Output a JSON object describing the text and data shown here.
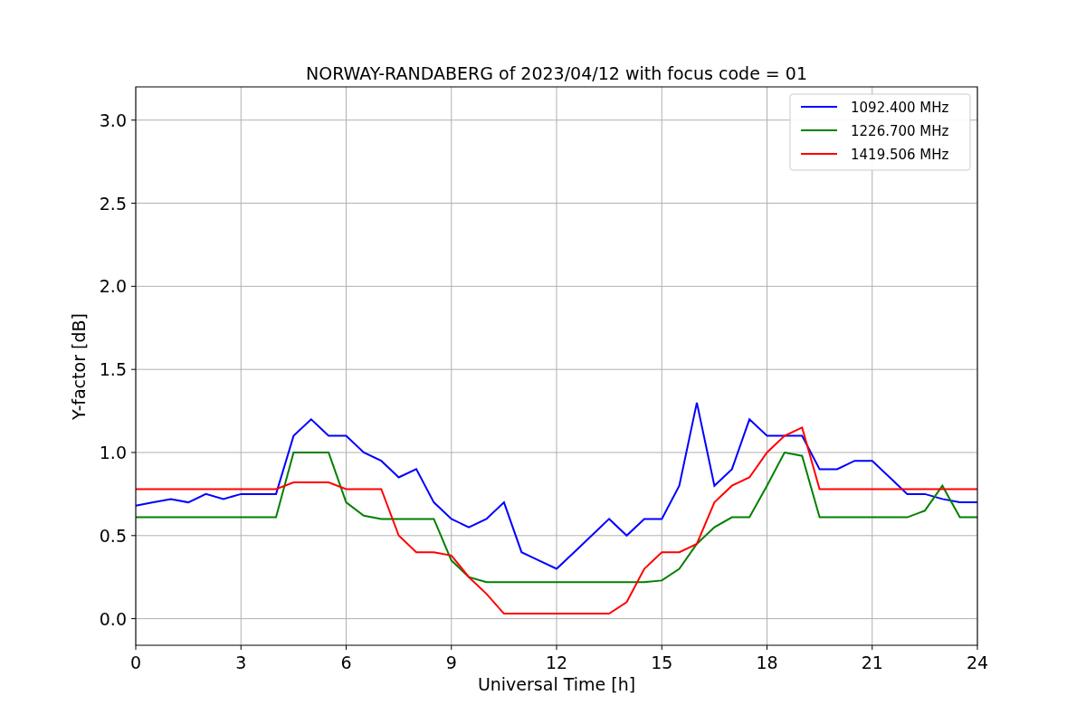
{
  "figure": {
    "chart_data": {
      "type": "line",
      "title": "NORWAY-RANDABERG of 2023/04/12 with focus code = 01",
      "xlabel": "Universal Time [h]",
      "ylabel": "Y-factor [dB]",
      "x": [
        0,
        0.5,
        1,
        1.5,
        2,
        2.5,
        3,
        3.5,
        4,
        4.5,
        5,
        5.5,
        6,
        6.5,
        7,
        7.5,
        8,
        8.5,
        9,
        9.5,
        10,
        10.5,
        11,
        11.5,
        12,
        12.5,
        13,
        13.5,
        14,
        14.5,
        15,
        15.5,
        16,
        16.5,
        17,
        17.5,
        18,
        18.5,
        19,
        19.5,
        20,
        20.5,
        21,
        21.5,
        22,
        22.5,
        23,
        23.5,
        24
      ],
      "series": [
        {
          "name": "1092.400 MHz",
          "color": "#0000ff",
          "values": [
            0.68,
            0.7,
            0.72,
            0.7,
            0.75,
            0.72,
            0.75,
            0.75,
            0.75,
            1.1,
            1.2,
            1.1,
            1.1,
            1.0,
            0.95,
            0.85,
            0.9,
            0.7,
            0.6,
            0.55,
            0.6,
            0.7,
            0.4,
            0.35,
            0.3,
            0.4,
            0.5,
            0.6,
            0.5,
            0.6,
            0.6,
            0.8,
            1.3,
            0.8,
            0.9,
            1.2,
            1.1,
            1.1,
            1.1,
            0.9,
            0.9,
            0.95,
            0.95,
            0.85,
            0.75,
            0.75,
            0.72,
            0.7,
            0.7
          ]
        },
        {
          "name": "1226.700 MHz",
          "color": "#008000",
          "values": [
            0.61,
            0.61,
            0.61,
            0.61,
            0.61,
            0.61,
            0.61,
            0.61,
            0.61,
            1.0,
            1.0,
            1.0,
            0.7,
            0.62,
            0.6,
            0.6,
            0.6,
            0.6,
            0.35,
            0.25,
            0.22,
            0.22,
            0.22,
            0.22,
            0.22,
            0.22,
            0.22,
            0.22,
            0.22,
            0.22,
            0.23,
            0.3,
            0.45,
            0.55,
            0.61,
            0.61,
            0.8,
            1.0,
            0.98,
            0.61,
            0.61,
            0.61,
            0.61,
            0.61,
            0.61,
            0.65,
            0.8,
            0.61,
            0.61
          ]
        },
        {
          "name": "1419.506 MHz",
          "color": "#ff0000",
          "values": [
            0.78,
            0.78,
            0.78,
            0.78,
            0.78,
            0.78,
            0.78,
            0.78,
            0.78,
            0.82,
            0.82,
            0.82,
            0.78,
            0.78,
            0.78,
            0.5,
            0.4,
            0.4,
            0.38,
            0.25,
            0.15,
            0.03,
            0.03,
            0.03,
            0.03,
            0.03,
            0.03,
            0.03,
            0.1,
            0.3,
            0.4,
            0.4,
            0.45,
            0.7,
            0.8,
            0.85,
            1.0,
            1.1,
            1.15,
            0.78,
            0.78,
            0.78,
            0.78,
            0.78,
            0.78,
            0.78,
            0.78,
            0.78,
            0.78
          ]
        }
      ],
      "grid": true,
      "legend": true,
      "xlim": [
        0,
        24
      ],
      "ylim": [
        -0.16,
        3.2
      ],
      "xticks": [
        0,
        3,
        6,
        9,
        12,
        15,
        18,
        21,
        24
      ],
      "yticks": [
        {
          "value": 0,
          "label": "0.0"
        },
        {
          "value": 0.5,
          "label": "0.5"
        },
        {
          "value": 1,
          "label": "1.0"
        },
        {
          "value": 1.5,
          "label": "1.5"
        },
        {
          "value": 2,
          "label": "2.0"
        },
        {
          "value": 2.5,
          "label": "2.5"
        },
        {
          "value": 3,
          "label": "3.0"
        }
      ]
    }
  }
}
